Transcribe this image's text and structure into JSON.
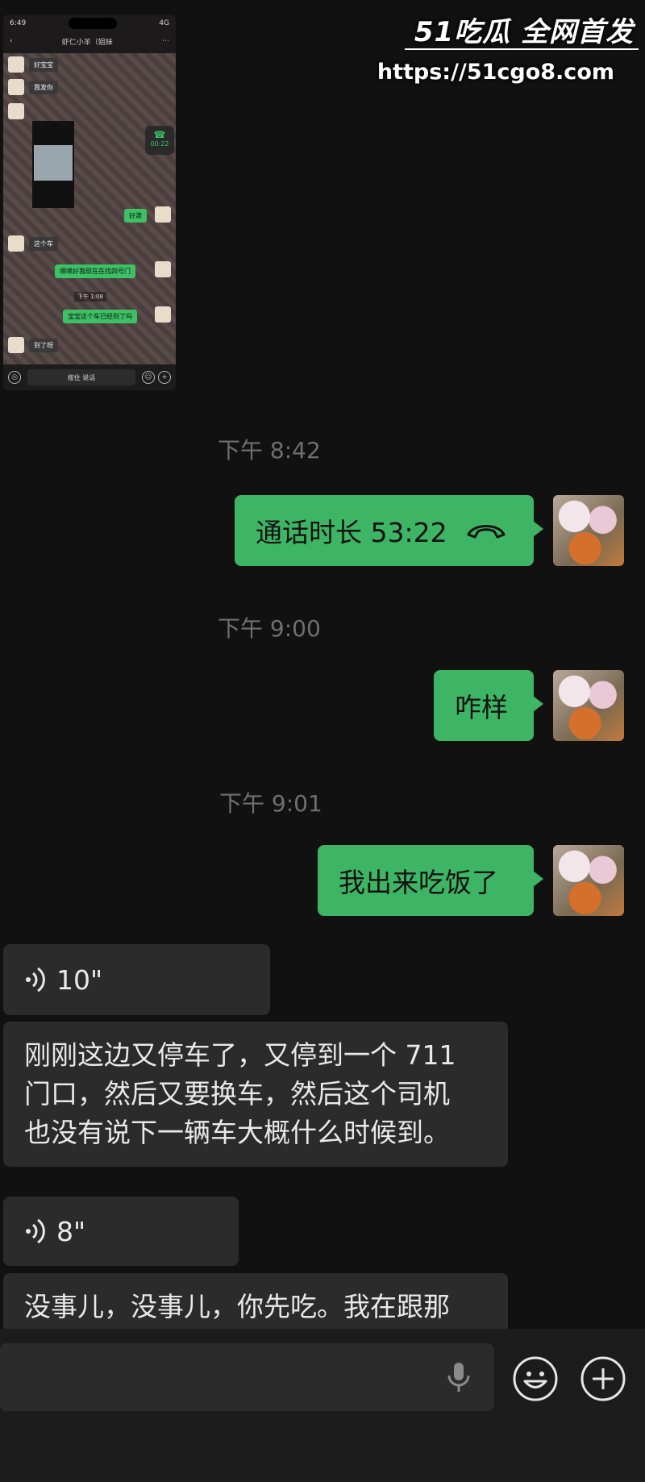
{
  "watermark": {
    "brand": "51吃瓜 全网首发",
    "url": "https://51cgo8.com"
  },
  "thumbnail": {
    "status_time": "6:49",
    "status_right": "4G",
    "chat_title": "虾仁小羊（姐妹",
    "call_badge_time": "00:22",
    "messages": [
      {
        "side": "left",
        "text": "好宝宝"
      },
      {
        "side": "left",
        "text": "我发你"
      },
      {
        "side": "right",
        "text": "好滴"
      },
      {
        "side": "left",
        "text": "这个车"
      },
      {
        "side": "right",
        "text": "嗯嗯好我现在在找四号门"
      },
      {
        "side": "right",
        "text": "宝宝这个车已经到了吗"
      },
      {
        "side": "left",
        "text": "到了呀"
      }
    ],
    "inner_time": "下午 1:08",
    "hold_to_talk": "按住 说话"
  },
  "chat": {
    "messages": [
      {
        "type": "time",
        "text": "下午 8:42"
      },
      {
        "type": "call",
        "side": "right",
        "text": "通话时长 53:22",
        "icon": "phone-hangup-icon"
      },
      {
        "type": "time",
        "text": "下午 9:00"
      },
      {
        "type": "text",
        "side": "right",
        "text": "咋样"
      },
      {
        "type": "time",
        "text": "下午 9:01"
      },
      {
        "type": "text",
        "side": "right",
        "text": "我出来吃饭了"
      },
      {
        "type": "voice",
        "side": "left",
        "duration": "10\""
      },
      {
        "type": "transcript",
        "side": "left",
        "lines": [
          "刚刚这边又停车了，又停到一个 711",
          "门口，然后又要换车，然后这个司机",
          "也没有说下一辆车大概什么时候到。"
        ]
      },
      {
        "type": "voice",
        "side": "left",
        "duration": "8\""
      },
      {
        "type": "transcript",
        "side": "left",
        "lines": [
          "没事儿，没事儿，你先吃。我在跟那"
        ]
      }
    ]
  },
  "input_bar": {
    "icons": [
      "microphone-icon",
      "emoji-icon",
      "plus-icon"
    ]
  },
  "colors": {
    "background": "#111111",
    "outgoing_bubble": "#3eb565",
    "incoming_bubble": "#2b2b2b",
    "timestamp": "#6f6f6f"
  }
}
